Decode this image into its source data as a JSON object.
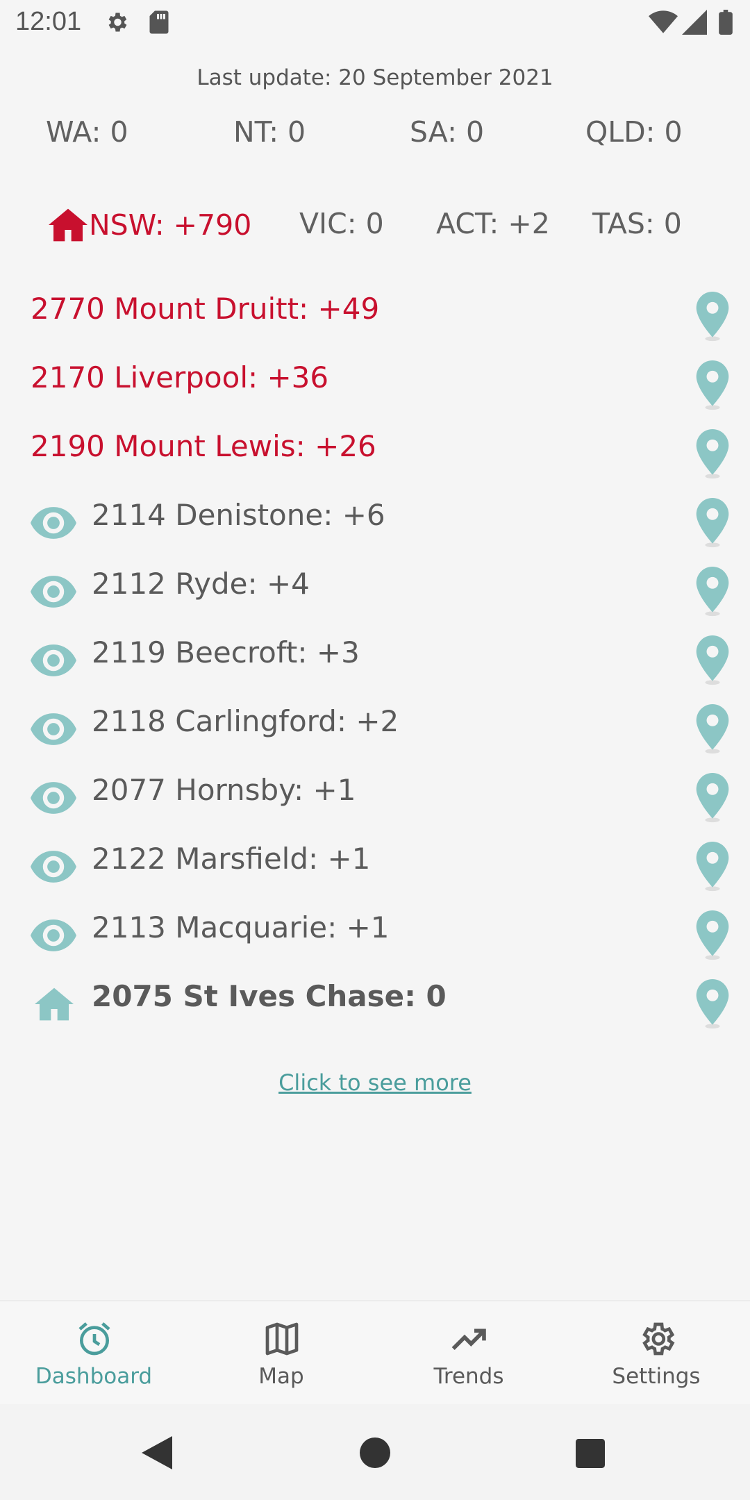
{
  "status_bar": {
    "time": "12:01",
    "icons": [
      "gear-icon",
      "sd-card-icon",
      "wifi-icon",
      "signal-icon",
      "battery-icon"
    ]
  },
  "last_update": "Last update: 20 September 2021",
  "states_row1": [
    {
      "label": "WA: 0"
    },
    {
      "label": "NT: 0"
    },
    {
      "label": "SA: 0"
    },
    {
      "label": "QLD: 0"
    }
  ],
  "states_row2": [
    {
      "label": "NSW: +790",
      "active": true,
      "icon": "home-icon"
    },
    {
      "label": "VIC: 0"
    },
    {
      "label": "ACT: +2"
    },
    {
      "label": "TAS: 0"
    }
  ],
  "suburbs": [
    {
      "label": "2770 Mount Druitt: +49",
      "kind": "hot"
    },
    {
      "label": "2170 Liverpool: +36",
      "kind": "hot"
    },
    {
      "label": "2190 Mount Lewis: +26",
      "kind": "hot"
    },
    {
      "label": "2114 Denistone: +6",
      "kind": "watch",
      "icon": "eye-icon"
    },
    {
      "label": "2112 Ryde: +4",
      "kind": "watch",
      "icon": "eye-icon"
    },
    {
      "label": "2119 Beecroft: +3",
      "kind": "watch",
      "icon": "eye-icon"
    },
    {
      "label": "2118 Carlingford: +2",
      "kind": "watch",
      "icon": "eye-icon"
    },
    {
      "label": "2077 Hornsby: +1",
      "kind": "watch",
      "icon": "eye-icon"
    },
    {
      "label": "2122 Marsfield: +1",
      "kind": "watch",
      "icon": "eye-icon"
    },
    {
      "label": "2113 Macquarie: +1",
      "kind": "watch",
      "icon": "eye-icon"
    },
    {
      "label": "2075 St Ives Chase: 0",
      "kind": "home",
      "icon": "home-icon"
    }
  ],
  "see_more": "Click to see more",
  "bottom_nav": [
    {
      "label": "Dashboard",
      "icon": "alarm-clock-icon",
      "active": true
    },
    {
      "label": "Map",
      "icon": "map-icon"
    },
    {
      "label": "Trends",
      "icon": "trending-up-icon"
    },
    {
      "label": "Settings",
      "icon": "settings-gear-icon"
    }
  ],
  "colors": {
    "accent": "#4a9d9c",
    "alert": "#c8102e",
    "pin": "#8cc6c5",
    "text": "#5a5a5a"
  }
}
